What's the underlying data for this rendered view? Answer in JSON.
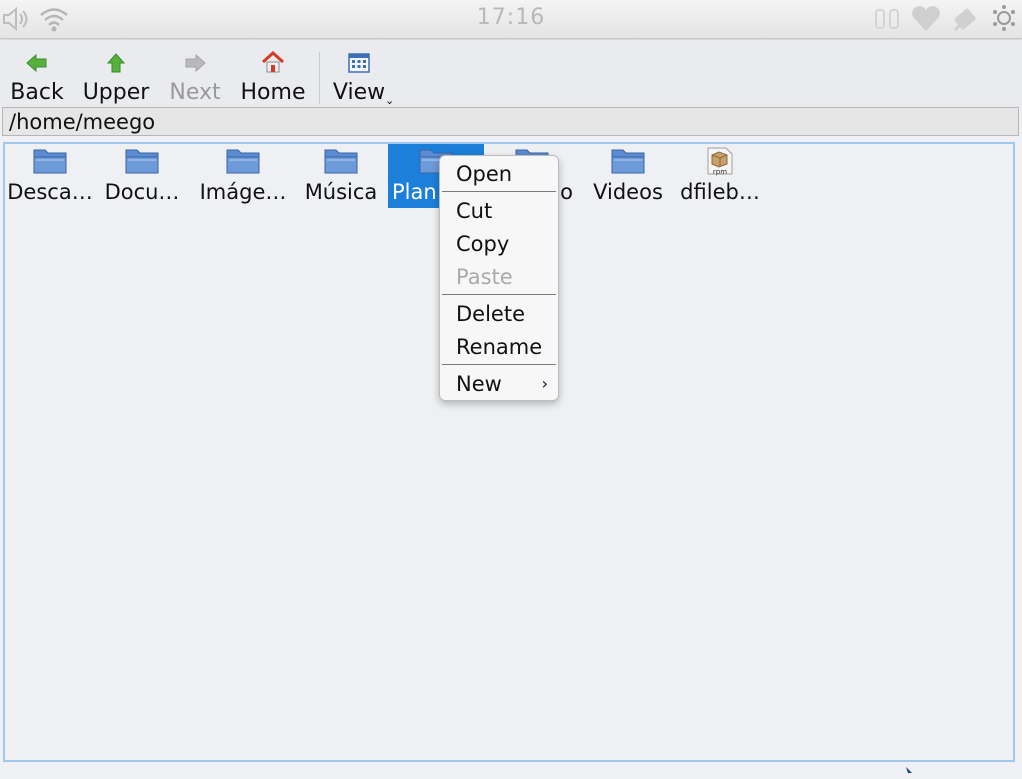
{
  "statusbar": {
    "time": "17:16",
    "icons": [
      "volume-icon",
      "wifi-icon",
      "bluetooth-icon",
      "heart-icon",
      "usb-icon",
      "settings-icon"
    ]
  },
  "toolbar": {
    "back_label": "Back",
    "upper_label": "Upper",
    "next_label": "Next",
    "home_label": "Home",
    "view_label": "View"
  },
  "pathbar": {
    "path": "/home/meego"
  },
  "files": [
    {
      "name": "Desca…",
      "type": "folder"
    },
    {
      "name": "Docu…",
      "type": "folder"
    },
    {
      "name": "Imáge…",
      "type": "folder"
    },
    {
      "name": "Música",
      "type": "folder"
    },
    {
      "name": "Plan",
      "type": "folder",
      "selected": true
    },
    {
      "name": "o",
      "type": "folder"
    },
    {
      "name": "Videos",
      "type": "folder"
    },
    {
      "name": "dfileb…",
      "type": "rpm"
    }
  ],
  "context_menu": {
    "open": "Open",
    "cut": "Cut",
    "copy": "Copy",
    "paste": "Paste",
    "delete": "Delete",
    "rename": "Rename",
    "new": "New",
    "submenu_arrow": "›"
  },
  "colors": {
    "selection": "#1c7fd9",
    "folder": "#5b8bd1",
    "home_roof": "#d23a2a",
    "nav_arrow": "#55b03c"
  }
}
